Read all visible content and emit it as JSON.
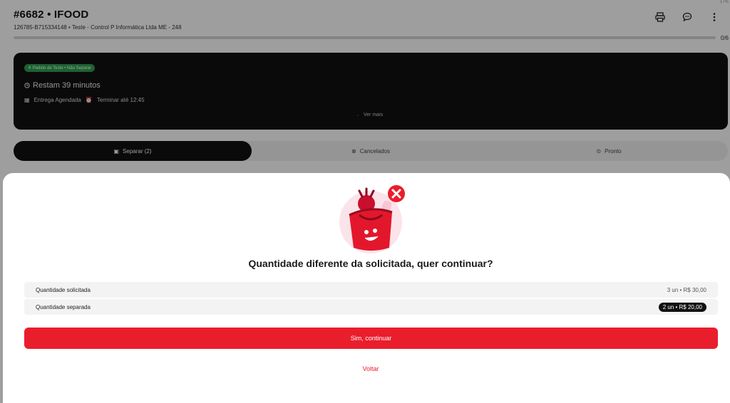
{
  "corner_mark": "17%",
  "header": {
    "title": "#6682 • IFOOD",
    "subtitle": "126785-B715334148 • Teste - Control P Informática Ltda ME - 248",
    "icons": [
      "print-icon",
      "chat-icon",
      "more-vertical-icon"
    ]
  },
  "progress": {
    "label": "0/6",
    "fraction": 0.0
  },
  "order_card": {
    "tag": "Pedido de Teste • Não Separar",
    "remaining": "Restam 39 minutos",
    "delivery": "Entrega Agendada",
    "deadline": "Terminar até 12:45",
    "more": "Ver mais"
  },
  "tabs": [
    {
      "label": "Separar (2)",
      "icon": "basket-icon"
    },
    {
      "label": "Cancelados",
      "icon": "cancel-circle-icon"
    },
    {
      "label": "Pronto",
      "icon": "check-circle-icon"
    }
  ],
  "modal": {
    "title": "Quantidade diferente da solicitada, quer continuar?",
    "rows": [
      {
        "label": "Quantidade solicitada",
        "value": "3 un • R$ 30,00"
      },
      {
        "label": "Quantidade separada",
        "value": "2 un • R$ 20,00"
      }
    ],
    "primary_button": "Sim, continuar",
    "secondary_button": "Voltar"
  },
  "colors": {
    "accent": "#ea1d2c",
    "dark": "#111111",
    "tag_green": "#2e9e4f"
  }
}
